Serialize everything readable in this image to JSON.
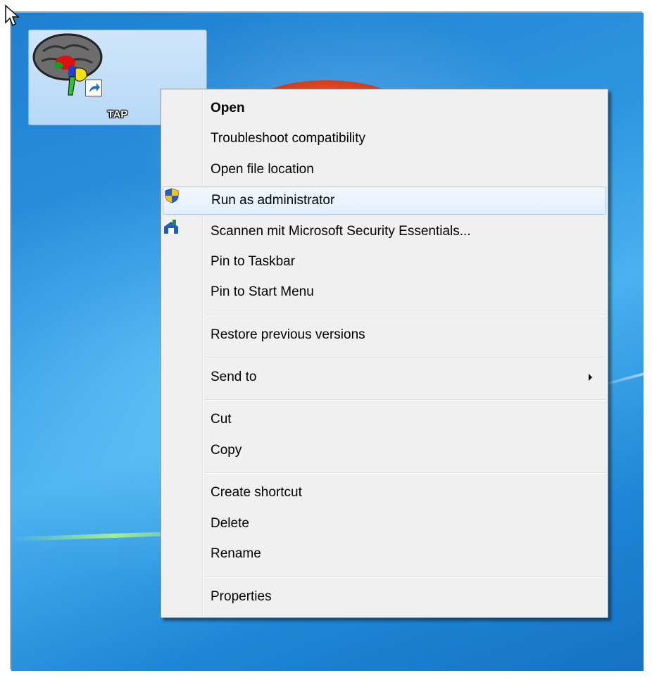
{
  "desktop": {
    "icon_label": "TAP"
  },
  "context_menu": {
    "items": [
      {
        "label": "Open"
      },
      {
        "label": "Troubleshoot compatibility"
      },
      {
        "label": "Open file location"
      },
      {
        "label": "Run as administrator",
        "icon": "uac-shield-icon"
      },
      {
        "label": "Scannen mit Microsoft Security Essentials...",
        "icon": "security-essentials-icon"
      },
      {
        "label": "Pin to Taskbar"
      },
      {
        "label": "Pin to Start Menu"
      },
      {
        "label": "Restore previous versions"
      },
      {
        "label": "Send to"
      },
      {
        "label": "Cut"
      },
      {
        "label": "Copy"
      },
      {
        "label": "Create shortcut"
      },
      {
        "label": "Delete"
      },
      {
        "label": "Rename"
      },
      {
        "label": "Properties"
      }
    ]
  },
  "colors": {
    "desktop_blue": "#2d95e0",
    "menu_background": "#f0f0f0",
    "hover_border": "#a8c8ee"
  }
}
